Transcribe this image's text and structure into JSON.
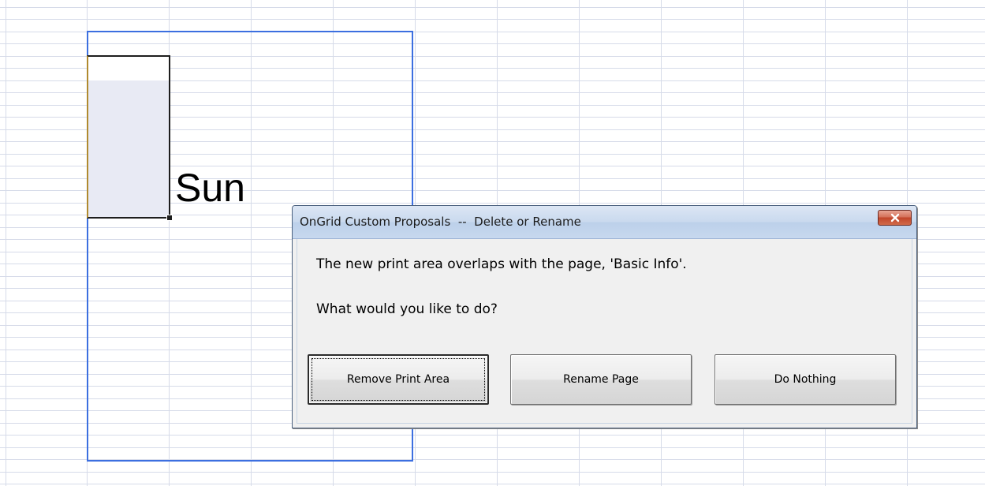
{
  "spreadsheet": {
    "cell_text": "Sun"
  },
  "dialog": {
    "title": "OnGrid Custom Proposals  --  Delete or Rename",
    "message_line1": "The new print area overlaps with the page, 'Basic Info'.",
    "message_line2": "What would you like to do?",
    "buttons": {
      "remove_print_area": "Remove Print Area",
      "rename_page": "Rename Page",
      "do_nothing": "Do Nothing"
    },
    "close_icon": "close-icon"
  },
  "colors": {
    "print_area_border": "#3c6fe0",
    "grid_line": "#d6dbe9",
    "close_button": "#c2452a"
  }
}
